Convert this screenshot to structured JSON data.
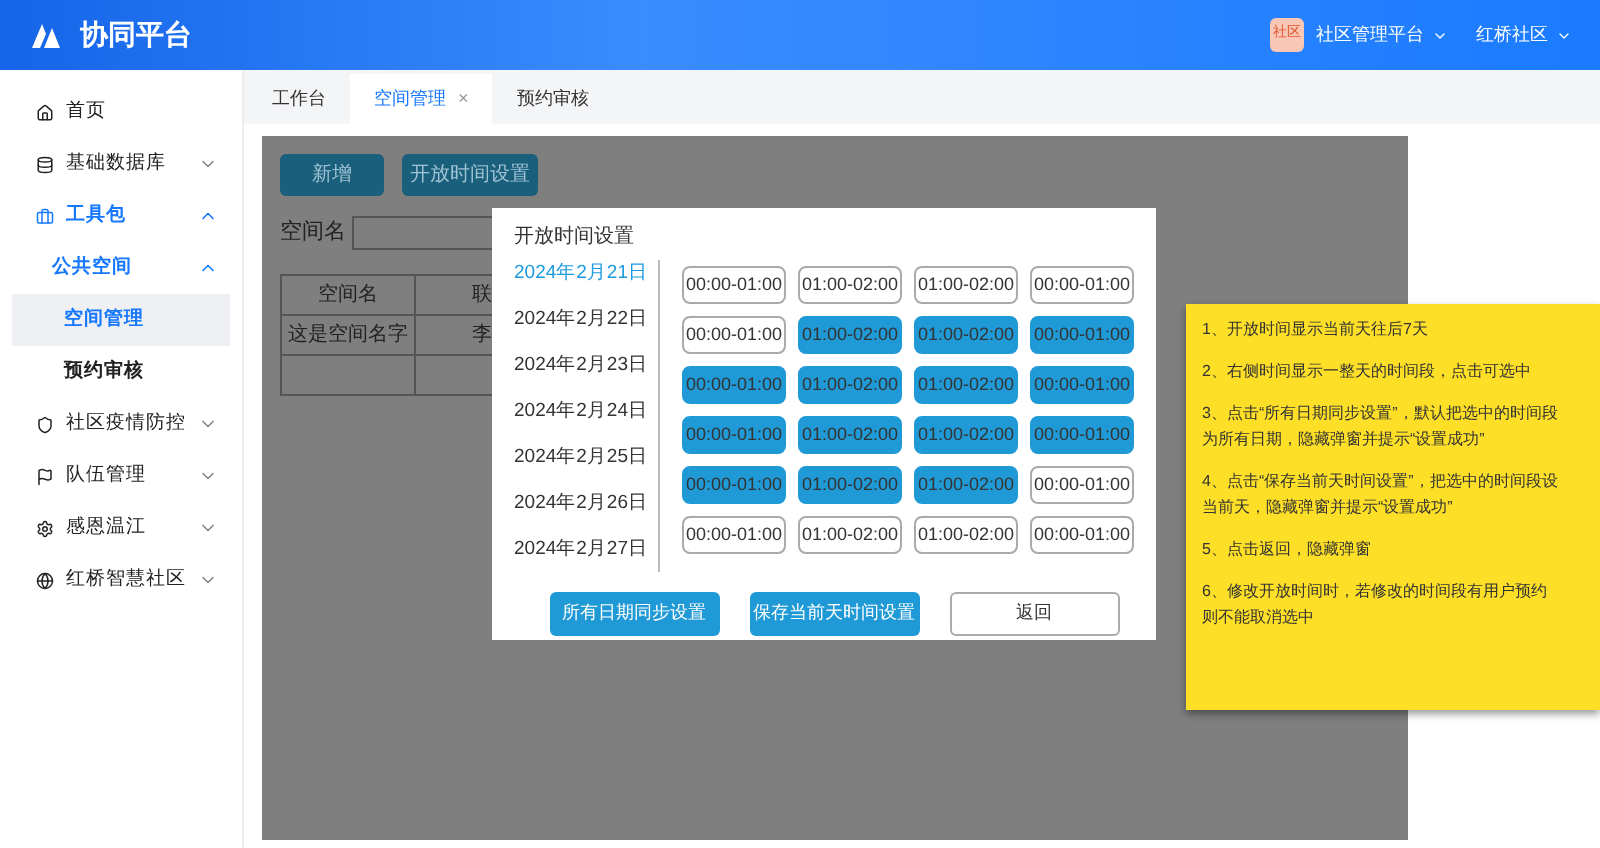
{
  "header": {
    "title": "协同平台",
    "badge": "社区",
    "platform": "社区管理平台",
    "community": "红桥社区"
  },
  "sidebar": {
    "items": [
      {
        "label": "首页",
        "selected": false
      },
      {
        "label": "基础数据库",
        "expanded": false,
        "selected": false
      },
      {
        "label": "工具包",
        "expanded": true,
        "selected": false,
        "children": [
          {
            "label": "公共空间",
            "expanded": true,
            "selected": false,
            "children": [
              {
                "label": "空间管理",
                "selected": true
              },
              {
                "label": "预约审核",
                "selected": false
              }
            ]
          }
        ]
      },
      {
        "label": "社区疫情防控",
        "expanded": false,
        "selected": false
      },
      {
        "label": "队伍管理",
        "expanded": false,
        "selected": false
      },
      {
        "label": "感恩温江",
        "expanded": false,
        "selected": false
      },
      {
        "label": "红桥智慧社区",
        "expanded": false,
        "selected": false
      }
    ]
  },
  "tabs": [
    {
      "label": "工作台",
      "selected": false
    },
    {
      "label": "空间管理",
      "selected": true,
      "close": "×"
    },
    {
      "label": "预约审核",
      "selected": false
    }
  ],
  "content": {
    "buttons": [
      "新增",
      "开放时间设置"
    ],
    "search_label": "空间名",
    "table": {
      "columns": [
        "空间名",
        "联"
      ],
      "rows": [
        [
          "这是空间名字",
          "李"
        ]
      ]
    }
  },
  "dialog": {
    "title": "开放时间设置",
    "dates": [
      {
        "label": "2024年2月21日",
        "selected": true
      },
      {
        "label": "2024年2月22日",
        "selected": false
      },
      {
        "label": "2024年2月23日",
        "selected": false
      },
      {
        "label": "2024年2月24日",
        "selected": false
      },
      {
        "label": "2024年2月25日",
        "selected": false
      },
      {
        "label": "2024年2月26日",
        "selected": false
      },
      {
        "label": "2024年2月27日",
        "selected": false
      }
    ],
    "slots": [
      [
        {
          "label": "00:00-01:00",
          "selected": false
        },
        {
          "label": "01:00-02:00",
          "selected": false
        },
        {
          "label": "01:00-02:00",
          "selected": false
        },
        {
          "label": "00:00-01:00",
          "selected": false
        }
      ],
      [
        {
          "label": "00:00-01:00",
          "selected": false
        },
        {
          "label": "01:00-02:00",
          "selected": true
        },
        {
          "label": "01:00-02:00",
          "selected": true
        },
        {
          "label": "00:00-01:00",
          "selected": true
        }
      ],
      [
        {
          "label": "00:00-01:00",
          "selected": true
        },
        {
          "label": "01:00-02:00",
          "selected": true
        },
        {
          "label": "01:00-02:00",
          "selected": true
        },
        {
          "label": "00:00-01:00",
          "selected": true
        }
      ],
      [
        {
          "label": "00:00-01:00",
          "selected": true
        },
        {
          "label": "01:00-02:00",
          "selected": true
        },
        {
          "label": "01:00-02:00",
          "selected": true
        },
        {
          "label": "00:00-01:00",
          "selected": true
        }
      ],
      [
        {
          "label": "00:00-01:00",
          "selected": true
        },
        {
          "label": "01:00-02:00",
          "selected": true
        },
        {
          "label": "01:00-02:00",
          "selected": true
        },
        {
          "label": "00:00-01:00",
          "selected": false
        }
      ],
      [
        {
          "label": "00:00-01:00",
          "selected": false
        },
        {
          "label": "01:00-02:00",
          "selected": false
        },
        {
          "label": "01:00-02:00",
          "selected": false
        },
        {
          "label": "00:00-01:00",
          "selected": false
        }
      ]
    ],
    "buttons": [
      {
        "label": "所有日期同步设置",
        "kind": "primary"
      },
      {
        "label": "保存当前天时间设置",
        "kind": "primary"
      },
      {
        "label": "返回",
        "kind": "default"
      }
    ]
  },
  "note": {
    "paragraphs": [
      [
        "1、开放时间显示当前天往后7天"
      ],
      [
        "2、右侧时间显示一整天的时间段，点击可选中"
      ],
      [
        "3、点击“所有日期同步设置”，默认把选中的时间段",
        "为所有日期，隐藏弹窗并提示“设置成功”"
      ],
      [
        "4、点击“保存当前天时间设置”，把选中的时间段设",
        "当前天，隐藏弹窗并提示“设置成功”"
      ],
      [
        "5、点击返回，隐藏弹窗"
      ],
      [
        "6、修改开放时间时，若修改的时间段有用户预约",
        "则不能取消选中"
      ]
    ]
  }
}
